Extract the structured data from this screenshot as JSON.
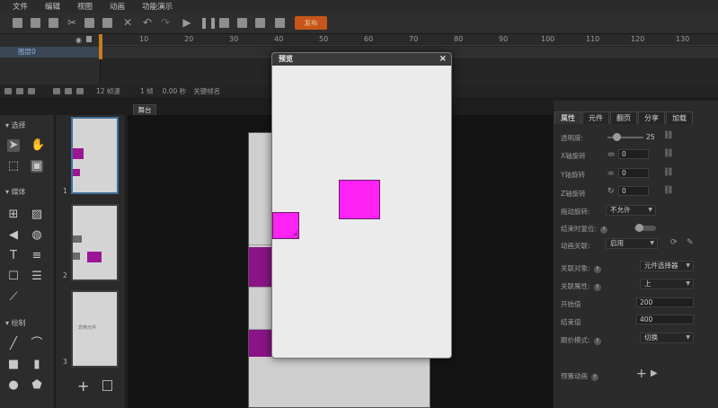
{
  "menu": [
    "文件",
    "编辑",
    "视图",
    "动画",
    "功能演示"
  ],
  "toolbar": {
    "publish_label": "发布"
  },
  "timeline": {
    "ruler_ticks": [
      "10",
      "20",
      "30",
      "40",
      "50",
      "60",
      "70",
      "80",
      "90",
      "100",
      "110",
      "120",
      "130"
    ],
    "layer_name": "图层0",
    "status": {
      "fps": "12 帧速",
      "frame": "1 帧",
      "time": "0.00 秒",
      "keyframe": "关键帧名"
    }
  },
  "tools": {
    "select_label": "选择",
    "media_label": "媒体",
    "draw_label": "绘制"
  },
  "pages": [
    {
      "number": "1",
      "caption": ""
    },
    {
      "number": "2",
      "caption": ""
    },
    {
      "number": "3",
      "caption": "恐怖元件"
    }
  ],
  "stage": {
    "tab_label": "舞台"
  },
  "preview": {
    "title": "预览",
    "close_icon": "×"
  },
  "properties": {
    "tabs": [
      "属性",
      "元件",
      "翻页",
      "分享",
      "加载"
    ],
    "active_tab": "属性",
    "opacity_label": "透明度:",
    "opacity_value": "25",
    "x_rotate_label": "X轴旋转",
    "x_rotate_value": "0",
    "y_rotate_label": "Y轴旋转",
    "y_rotate_value": "0",
    "z_rotate_label": "Z轴旋转",
    "z_rotate_value": "0",
    "drag_rotate_label": "拖动旋转:",
    "drag_rotate_value": "不允许",
    "reset_label": "结束时复位:",
    "anim_link_label": "动画关联:",
    "anim_link_value": "启用",
    "target_label": "关联对象:",
    "target_value": "元件选择器",
    "attr_label": "关联属性:",
    "attr_value": "上",
    "start_label": "开始值",
    "start_value": "200",
    "end_label": "结束值",
    "end_value": "400",
    "mode_label": "跟价模式:",
    "mode_value": "切换",
    "preset_label": "预置动画"
  },
  "colors": {
    "accent": "#c8561a",
    "shape": "#ff22f5",
    "shape_dark": "#8a1486"
  }
}
